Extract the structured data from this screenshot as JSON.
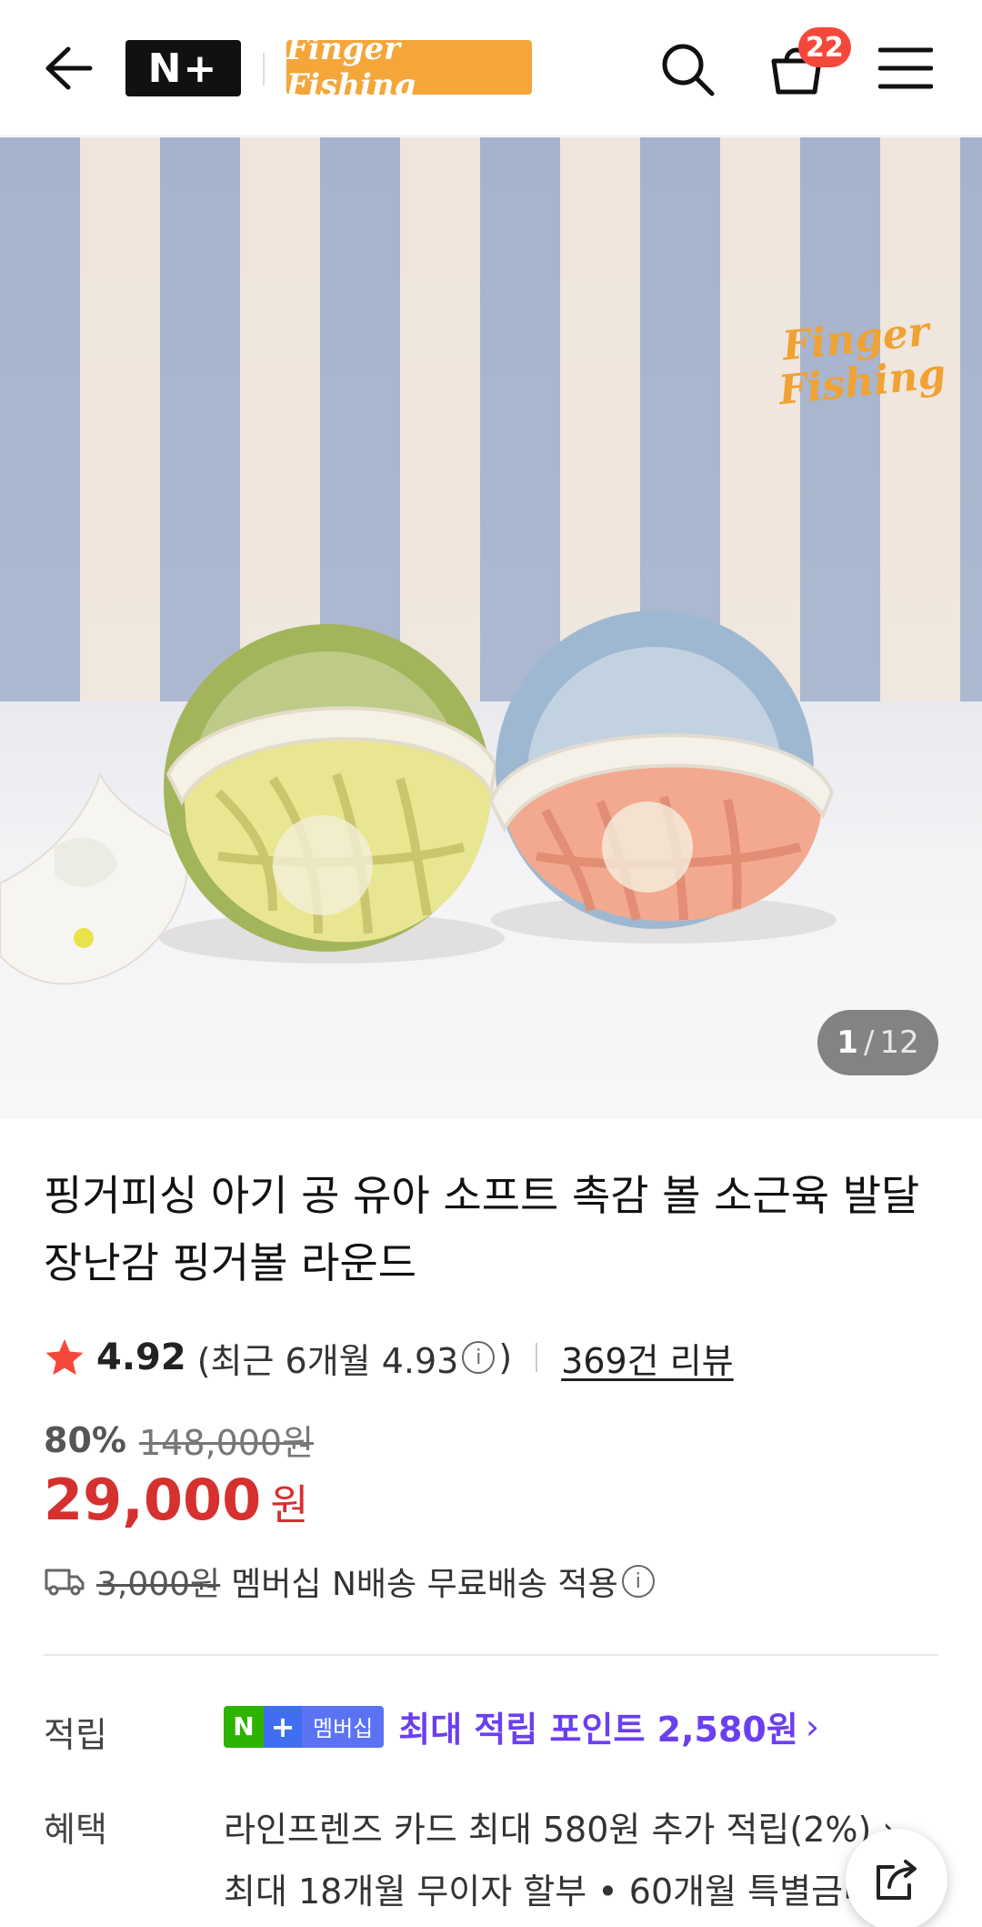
{
  "header": {
    "nplus_logo": "N+",
    "brand_name": "Finger Fishing",
    "cart_count": "22"
  },
  "hero": {
    "watermark": "Finger Fishing",
    "image_index": "1",
    "image_sep": "/",
    "image_total": "12",
    "colors": {
      "wall_blue": "#a6b3cc",
      "wall_cream": "#efe5dc"
    }
  },
  "product": {
    "title": "핑거피싱 아기 공 유아 소프트 촉감 볼 소근육 발달 장난감 핑거볼 라운드",
    "rating": "4.92",
    "recent_prefix": "(최근 6개월 4.93",
    "recent_suffix": ")",
    "info_glyph": "i",
    "review_count": "369건 리뷰",
    "discount": "80%",
    "original_price": "148,000원",
    "price": "29,000",
    "currency": "원",
    "shipping_fee": "3,000원",
    "shipping_note": "멤버십 N배송 무료배송 적용"
  },
  "benefits": {
    "points_label": "적립",
    "badge_n": "N",
    "badge_plus": "+",
    "badge_text": "멤버십",
    "points_text": "최대 적립 포인트 2,580원",
    "points_chevron": "›",
    "benefit_label": "혜택",
    "benefit_line1": "라인프렌즈 카드 최대 580원 추가 적립(2%) ›",
    "benefit_line2": "최대 18개월 무이자 할부 • 60개월 특별금리"
  },
  "colors": {
    "price_red": "#d6302f",
    "points_purple": "#6b3ff0",
    "badge_red": "#f5483b",
    "brand_orange": "#f4a63a"
  }
}
